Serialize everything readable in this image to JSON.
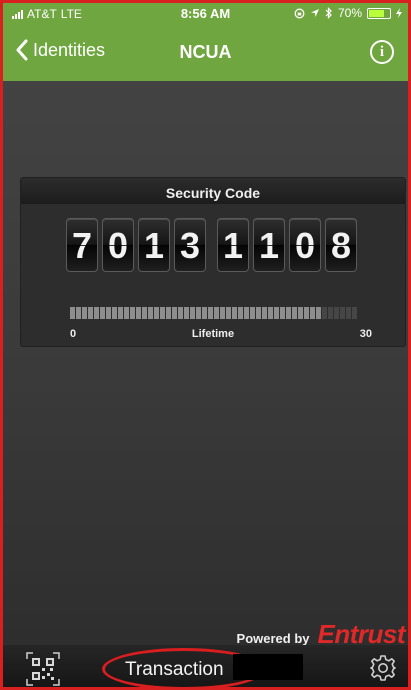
{
  "status_bar": {
    "carrier": "AT&T",
    "network": "LTE",
    "time": "8:56 AM",
    "battery": "70%"
  },
  "nav": {
    "back_label": "Identities",
    "title": "NCUA",
    "info_icon": "info-icon"
  },
  "security_code": {
    "title": "Security Code",
    "digits": [
      "7",
      "0",
      "1",
      "3",
      "1",
      "1",
      "0",
      "8"
    ],
    "lifetime": {
      "label": "Lifetime",
      "min": "0",
      "max": "30",
      "elapsed_fraction": 0.87
    }
  },
  "branding": {
    "powered_by": "Powered by",
    "brand": "Entrust",
    "brand_color": "#e02828"
  },
  "bottom_bar": {
    "qr_icon": "qr-code-icon",
    "transaction_label": "Transaction",
    "settings_icon": "gear-icon"
  },
  "colors": {
    "header_green": "#6fa63f",
    "annotation_red": "#d81e1e"
  }
}
